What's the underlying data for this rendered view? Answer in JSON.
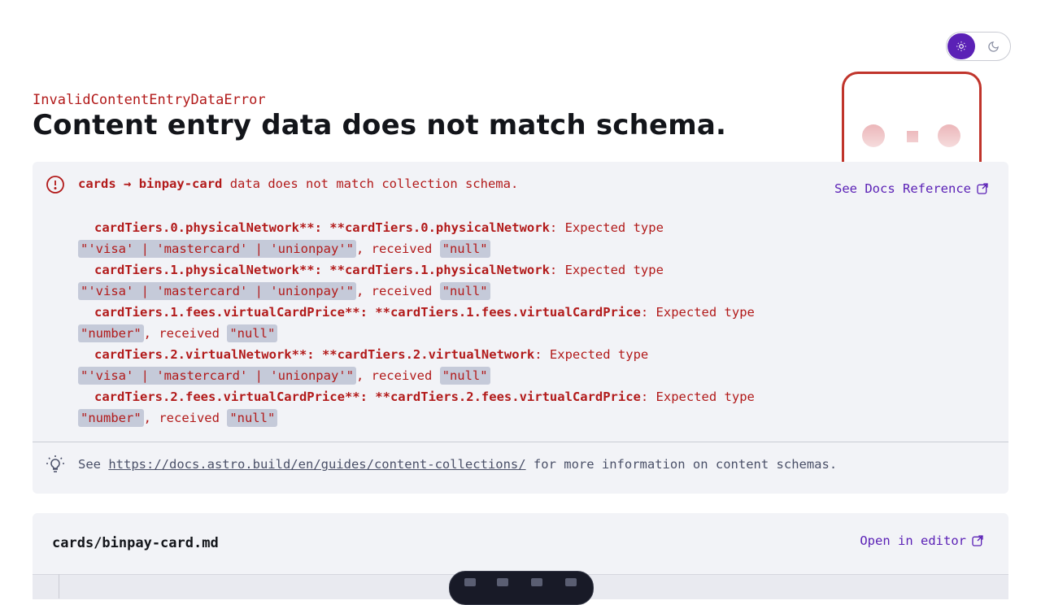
{
  "theme": {
    "light_icon": "sun-icon",
    "dark_icon": "moon-icon",
    "active": "light",
    "accent": "#5b21b6"
  },
  "error": {
    "name": "InvalidContentEntryDataError",
    "title": "Content entry data does not match schema.",
    "collection": "cards",
    "arrow": "→",
    "entry": "binpay-card",
    "summary": " data does not match collection schema.",
    "docs_label": "See Docs Reference",
    "lines": [
      {
        "field": "cardTiers.0.physicalNetwork**: **cardTiers.0.physicalNetwork",
        "text": ": Expected type",
        "expected": "\"'visa' | 'mastercard' | 'unionpay'\"",
        "received_label": ", received ",
        "received": "\"null\""
      },
      {
        "field": "cardTiers.1.physicalNetwork**: **cardTiers.1.physicalNetwork",
        "text": ": Expected type",
        "expected": "\"'visa' | 'mastercard' | 'unionpay'\"",
        "received_label": ", received ",
        "received": "\"null\""
      },
      {
        "field": "cardTiers.1.fees.virtualCardPrice**: **cardTiers.1.fees.virtualCardPrice",
        "text": ": Expected type",
        "expected": "\"number\"",
        "received_label": ", received ",
        "received": "\"null\""
      },
      {
        "field": "cardTiers.2.virtualNetwork**: **cardTiers.2.virtualNetwork",
        "text": ": Expected type",
        "expected": "\"'visa' | 'mastercard' | 'unionpay'\"",
        "received_label": ", received ",
        "received": "\"null\""
      },
      {
        "field": "cardTiers.2.fees.virtualCardPrice**: **cardTiers.2.fees.virtualCardPrice",
        "text": ": Expected type",
        "expected": "\"number\"",
        "received_label": ", received ",
        "received": "\"null\""
      }
    ],
    "hint_prefix": "See ",
    "hint_link": "https://docs.astro.build/en/guides/content-collections/",
    "hint_suffix": " for more information on content schemas."
  },
  "file": {
    "path": "cards/binpay-card.md",
    "open_label": "Open in editor"
  },
  "colors": {
    "error": "#b21a1a",
    "chip": "#c5cad9",
    "panel": "#f2f3f7"
  }
}
